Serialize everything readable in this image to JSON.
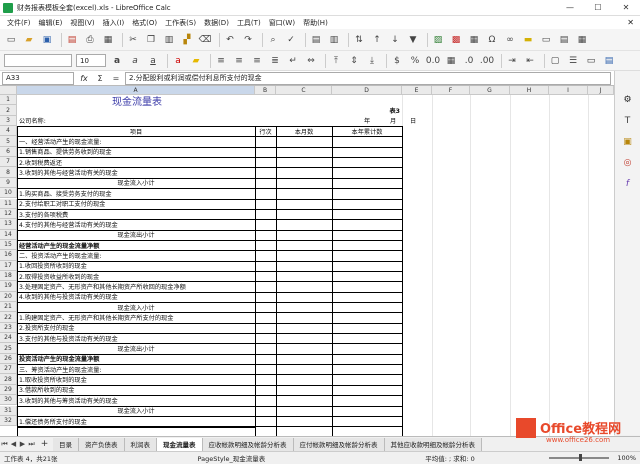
{
  "window": {
    "title": "财务报表模板全套(excel).xls - LibreOffice Calc",
    "minimize": "—",
    "maximize": "☐",
    "close": "✕"
  },
  "menu": {
    "items": [
      "文件(F)",
      "编辑(E)",
      "视图(V)",
      "插入(I)",
      "格式(O)",
      "工作表(S)",
      "数据(D)",
      "工具(T)",
      "窗口(W)",
      "帮助(H)"
    ],
    "close": "✕"
  },
  "toolbar2": {
    "font_size": "10"
  },
  "formula_bar": {
    "name_box": "A33",
    "content": "2.分配股利或利润或偿付利息所支付的现金",
    "fx": "fx",
    "sum": "Σ",
    "eq": "="
  },
  "columns": [
    "A",
    "B",
    "C",
    "D",
    "E",
    "F",
    "G",
    "H",
    "I",
    "J"
  ],
  "rows": [
    {
      "n": "1",
      "a": "现金流量表",
      "b": "",
      "c": "",
      "d": ""
    },
    {
      "n": "2",
      "a": "",
      "b": "",
      "c": "",
      "d": "表3"
    },
    {
      "n": "3",
      "a": "公司名称:",
      "b": "",
      "c": "",
      "d": "年",
      "d2": "月",
      "e": "日"
    },
    {
      "n": "4",
      "a": "项目",
      "b": "行次",
      "c": "本月数",
      "d": "本年累计数"
    },
    {
      "n": "5",
      "a": "一、经营活动产生的现金流量:"
    },
    {
      "n": "6",
      "a": "1.销售商品、提供劳务收到的现金"
    },
    {
      "n": "7",
      "a": "2.收到税费返还"
    },
    {
      "n": "8",
      "a": "3.收到的其他与经营活动有关的现金"
    },
    {
      "n": "9",
      "a": "现金流入小计"
    },
    {
      "n": "10",
      "a": "1.购买商品、接受劳务支付的现金"
    },
    {
      "n": "11",
      "a": "2.支付给职工对职工支付的现金"
    },
    {
      "n": "12",
      "a": "3.支付的各项税费"
    },
    {
      "n": "13",
      "a": "4.支付的其他与经营活动有关的现金"
    },
    {
      "n": "14",
      "a": "现金流出小计"
    },
    {
      "n": "15",
      "a": "经营活动产生的现金流量净额"
    },
    {
      "n": "16",
      "a": "二、投资活动产生的现金流量:"
    },
    {
      "n": "17",
      "a": "1.收回投资所收到的现金"
    },
    {
      "n": "18",
      "a": "2.取得投资收益所收到的现金"
    },
    {
      "n": "19",
      "a": "3.处理固定资产、无形资产和其他长期资产所收回的现金净额"
    },
    {
      "n": "20",
      "a": "4.收到的其他与投资活动有关的现金"
    },
    {
      "n": "21",
      "a": "现金流入小计"
    },
    {
      "n": "22",
      "a": "1.购建固定资产、无形资产和其他长期资产所支付的现金"
    },
    {
      "n": "23",
      "a": "2.投资所支付的现金"
    },
    {
      "n": "24",
      "a": "3.支付的其他与投资活动有关的现金"
    },
    {
      "n": "25",
      "a": "现金流出小计"
    },
    {
      "n": "26",
      "a": "投资活动产生的现金流量净额"
    },
    {
      "n": "27",
      "a": "三、筹资活动产生的现金流量:"
    },
    {
      "n": "28",
      "a": "1.取收投资所收到的现金"
    },
    {
      "n": "29",
      "a": "3.借款所收到的现金"
    },
    {
      "n": "30",
      "a": "3.收到的其他与筹资活动有关的现金"
    },
    {
      "n": "31",
      "a": "现金流入小计"
    },
    {
      "n": "32",
      "a": "1.偿还债务所支付的现金"
    }
  ],
  "tabs": [
    "目录",
    "资产负债表",
    "利润表",
    "现金流量表",
    "应收帐款明细及帐龄分析表",
    "应付帐款明细及帐龄分析表",
    "其他应收款明细及帐龄分析表"
  ],
  "active_tab": "现金流量表",
  "status": {
    "sheet": "工作表 4，共21张",
    "page_style": "PageStyle_现金流量表",
    "avg": "平均值: ; 求和: 0",
    "zoom": "100%",
    "zoom_value": 0.5
  },
  "watermark": {
    "name": "Office教程网",
    "url": "www.office26.com"
  }
}
